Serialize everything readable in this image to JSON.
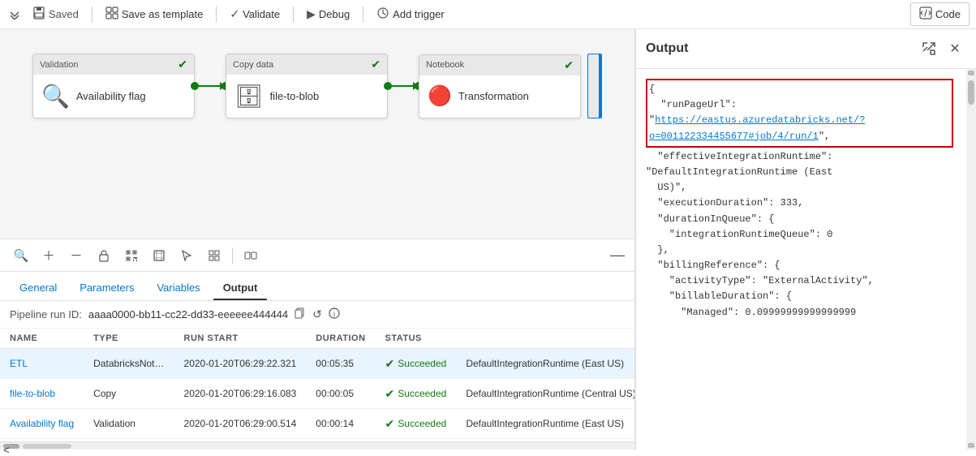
{
  "toolbar": {
    "saved_label": "Saved",
    "save_as_template_label": "Save as template",
    "validate_label": "Validate",
    "debug_label": "Debug",
    "add_trigger_label": "Add trigger",
    "code_label": "Code"
  },
  "pipeline": {
    "nodes": [
      {
        "id": "validation",
        "type_label": "Validation",
        "label": "Availability flag",
        "icon": "🔍",
        "success": true
      },
      {
        "id": "copy",
        "type_label": "Copy data",
        "label": "file-to-blob",
        "icon": "🗄",
        "success": true
      },
      {
        "id": "notebook",
        "type_label": "Notebook",
        "label": "Transformation",
        "icon": "🔷",
        "success": true
      }
    ]
  },
  "bottom_tabs": [
    {
      "id": "general",
      "label": "General"
    },
    {
      "id": "parameters",
      "label": "Parameters"
    },
    {
      "id": "variables",
      "label": "Variables"
    },
    {
      "id": "output",
      "label": "Output",
      "active": true
    }
  ],
  "run_info": {
    "label": "Pipeline run ID:",
    "run_id": "aaaa0000-bb11-cc22-dd33-eeeeee444444"
  },
  "table": {
    "columns": [
      "NAME",
      "TYPE",
      "RUN START",
      "DURATION",
      "STATUS"
    ],
    "rows": [
      {
        "name": "ETL",
        "type": "DatabricksNot…",
        "run_start": "2020-01-20T06:29:22.321",
        "duration": "00:05:35",
        "status": "Succeeded",
        "runtime": "DefaultIntegrationRuntime (East US)",
        "active": true
      },
      {
        "name": "file-to-blob",
        "type": "Copy",
        "run_start": "2020-01-20T06:29:16.083",
        "duration": "00:00:05",
        "status": "Succeeded",
        "runtime": "DefaultIntegrationRuntime (Central US)",
        "active": false
      },
      {
        "name": "Availability flag",
        "type": "Validation",
        "run_start": "2020-01-20T06:29:00.514",
        "duration": "00:00:14",
        "status": "Succeeded",
        "runtime": "DefaultIntegrationRuntime (East US)",
        "active": false
      }
    ]
  },
  "output_panel": {
    "title": "Output",
    "content_lines": [
      "{",
      "  \"runPageUrl\": \"https://eastus.azuredatabricks.net/?o=001122334455677#job/4/run/1\",",
      "  \"effectiveIntegrationRuntime\": \"DefaultIntegrationRuntime (East US)\",",
      "  \"executionDuration\": 333,",
      "  \"durationInQueue\": {",
      "    \"integrationRuntimeQueue\": 0",
      "  },",
      "  \"billingReference\": {",
      "    \"activityType\": \"ExternalActivity\",",
      "    \"billableDuration\": {",
      "      \"Managed\": 0.09999999999999999"
    ],
    "url_text": "https://eastus.azuredatabricks.net/?o=001122334455677#job/4/run/1",
    "url_line": 1
  }
}
